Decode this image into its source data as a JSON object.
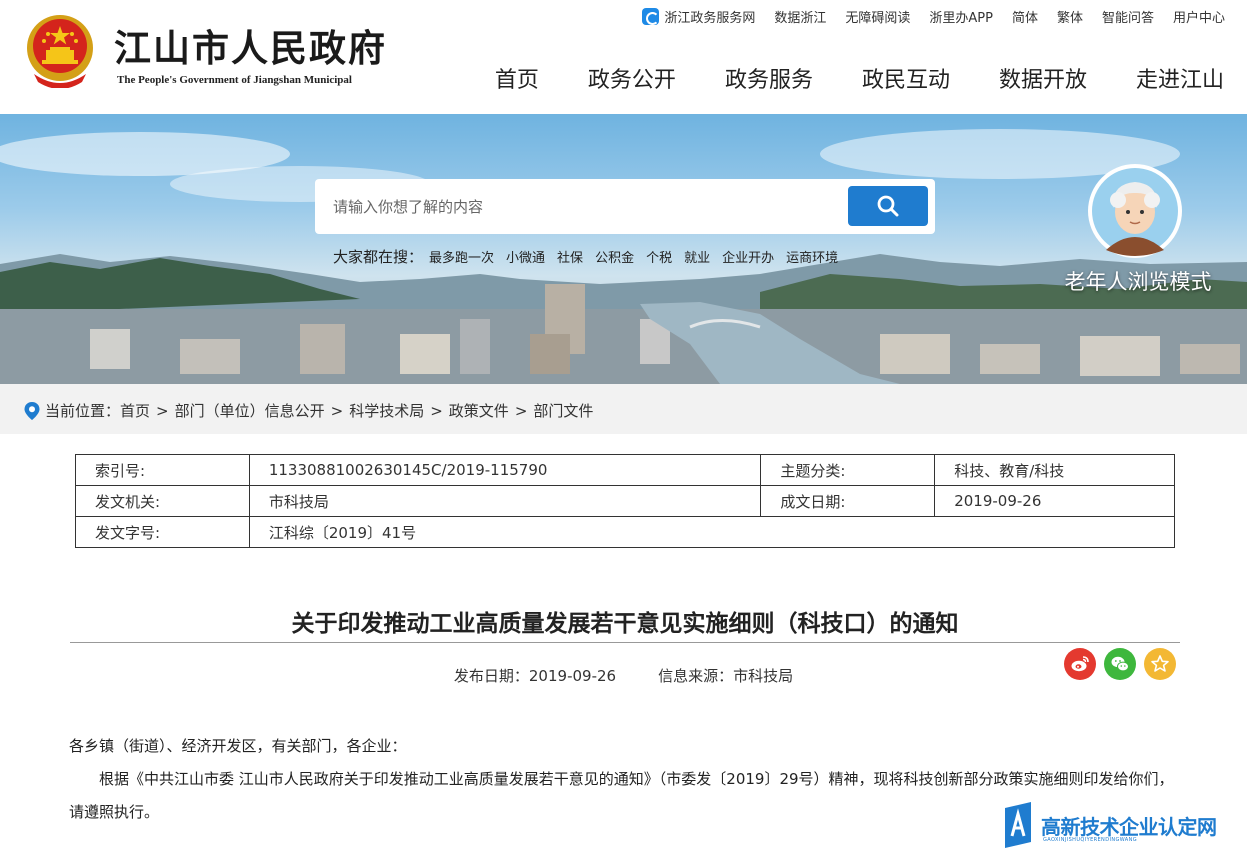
{
  "header": {
    "title": "江山市人民政府",
    "subtitle": "The People's Government of Jiangshan Municipal",
    "top_links": [
      "浙江政务服务网",
      "数据浙江",
      "无障碍阅读",
      "浙里办APP",
      "简体",
      "繁体",
      "智能问答",
      "用户中心"
    ],
    "nav": [
      "首页",
      "政务公开",
      "政务服务",
      "政民互动",
      "数据开放",
      "走进江山"
    ]
  },
  "banner": {
    "search_placeholder": "请输入你想了解的内容",
    "hot_label": "大家都在搜：",
    "hot_items": [
      "最多跑一次",
      "小微通",
      "社保",
      "公积金",
      "个税",
      "就业",
      "企业开办",
      "运商环境"
    ],
    "elder_mode_label": "老年人浏览模式"
  },
  "breadcrumb": {
    "label": "当前位置：",
    "items": [
      "首页",
      "部门（单位）信息公开",
      "科学技术局",
      "政策文件",
      "部门文件"
    ],
    "separator": ">"
  },
  "meta": {
    "rows": [
      {
        "k1": "索引号:",
        "v1": "11330881002630145C/2019-115790",
        "k2": "主题分类:",
        "v2": "科技、教育/科技"
      },
      {
        "k1": "发文机关:",
        "v1": "市科技局",
        "k2": "成文日期:",
        "v2": "2019-09-26"
      },
      {
        "k1": "发文字号:",
        "v1": "江科综〔2019〕41号",
        "k2": "",
        "v2": ""
      }
    ]
  },
  "article": {
    "title": "关于印发推动工业高质量发展若干意见实施细则（科技口）的通知",
    "publish_date": "发布日期：2019-09-26",
    "source": "信息来源：市科技局",
    "paragraphs": [
      "各乡镇（街道）、经济开发区，有关部门，各企业：",
      "根据《中共江山市委 江山市人民政府关于印发推动工业高质量发展若干意见的通知》（市委发〔2019〕29号）精神，现将科技创新部分政策实施细则印发给你们，请遵照执行。"
    ]
  },
  "share": {
    "icons": [
      "weibo-icon",
      "wechat-icon",
      "star-icon"
    ]
  },
  "watermark": {
    "text": "高新技术企业认定网",
    "subtext": "GAOXINJISHUQIYERENDINGWANG"
  },
  "colors": {
    "accent": "#1f7ccf",
    "weibo": "#e4392f",
    "wechat": "#3eb73d",
    "favorite": "#f3b834",
    "breadcrumb_bg": "#f2f2f2"
  }
}
